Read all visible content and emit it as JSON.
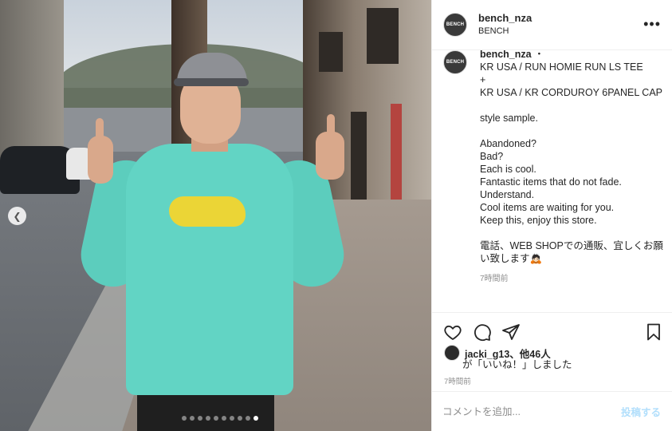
{
  "post": {
    "username": "bench_nza",
    "location": "BENCH",
    "avatar_text": "BENCH",
    "more_label": "•••"
  },
  "caption": {
    "username": "bench_nza",
    "separator": "・",
    "lines": [
      "KR USA / RUN HOMIE RUN LS TEE",
      "+",
      "KR USA / KR CORDUROY 6PANEL CAP",
      "",
      "style sample.",
      "",
      "Abandoned?",
      "Bad?",
      "Each is cool.",
      "Fantastic items that do not fade.",
      "Understand.",
      "Cool items are waiting for you.",
      "Keep this, enjoy this store.",
      "",
      "電話、WEB SHOPでの通販、宜しくお願",
      "い致します🙇🏻"
    ],
    "time": "7時間前"
  },
  "actions": {
    "like_icon": "heart-icon",
    "comment_icon": "comment-icon",
    "share_icon": "share-icon",
    "save_icon": "bookmark-icon"
  },
  "likes": {
    "line1": "jacki_g13、他46人",
    "line2": "が「いいね！」しました",
    "time": "7時間前"
  },
  "comment": {
    "placeholder": "コメントを追加...",
    "post_label": "投稿する"
  },
  "carousel": {
    "prev_icon": "chevron-left-icon",
    "dot_count": 10,
    "active_index": 9
  },
  "colors": {
    "accent": "#b2dffc",
    "shirt": "#62d4c4",
    "muted": "#8e8e8e"
  }
}
